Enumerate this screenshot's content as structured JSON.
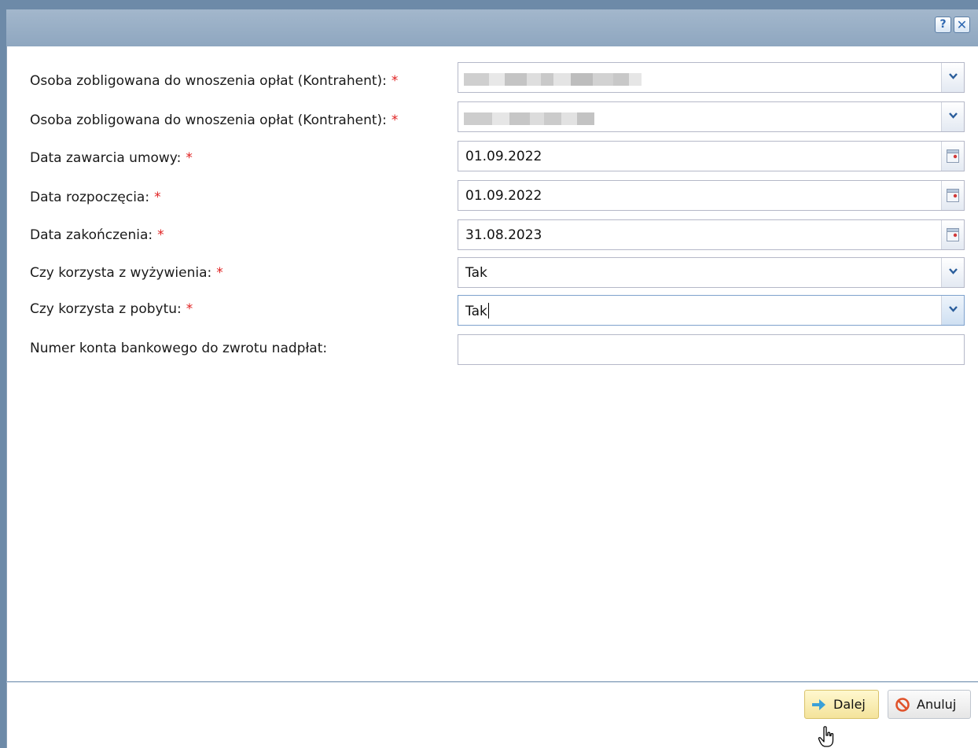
{
  "titlebar": {
    "help_label": "?",
    "close_label": "✕"
  },
  "form": {
    "fields": [
      {
        "label": "Osoba zobligowana do wnoszenia opłat (Kontrahent):",
        "required": true,
        "type": "combo",
        "value": ""
      },
      {
        "label": "Osoba zobligowana do wnoszenia opłat (Kontrahent):",
        "required": true,
        "type": "combo",
        "value": ""
      },
      {
        "label": "Data zawarcia umowy:",
        "required": true,
        "type": "date",
        "value": "01.09.2022"
      },
      {
        "label": "Data rozpoczęcia:",
        "required": true,
        "type": "date",
        "value": "01.09.2022"
      },
      {
        "label": "Data zakończenia:",
        "required": true,
        "type": "date",
        "value": "31.08.2023"
      },
      {
        "label": "Czy korzysta z wyżywienia:",
        "required": true,
        "type": "combo",
        "value": "Tak"
      },
      {
        "label": "Czy korzysta z pobytu:",
        "required": true,
        "type": "combo",
        "value": "Tak"
      },
      {
        "label": "Numer konta bankowego do zwrotu nadpłat:",
        "required": false,
        "type": "text",
        "value": ""
      }
    ],
    "required_marker": "*"
  },
  "footer": {
    "next_label": "Dalej",
    "cancel_label": "Anuluj"
  },
  "colors": {
    "required": "#e02020",
    "titlebar": "#8fa7c0",
    "hover_button": "#f4e39b"
  }
}
